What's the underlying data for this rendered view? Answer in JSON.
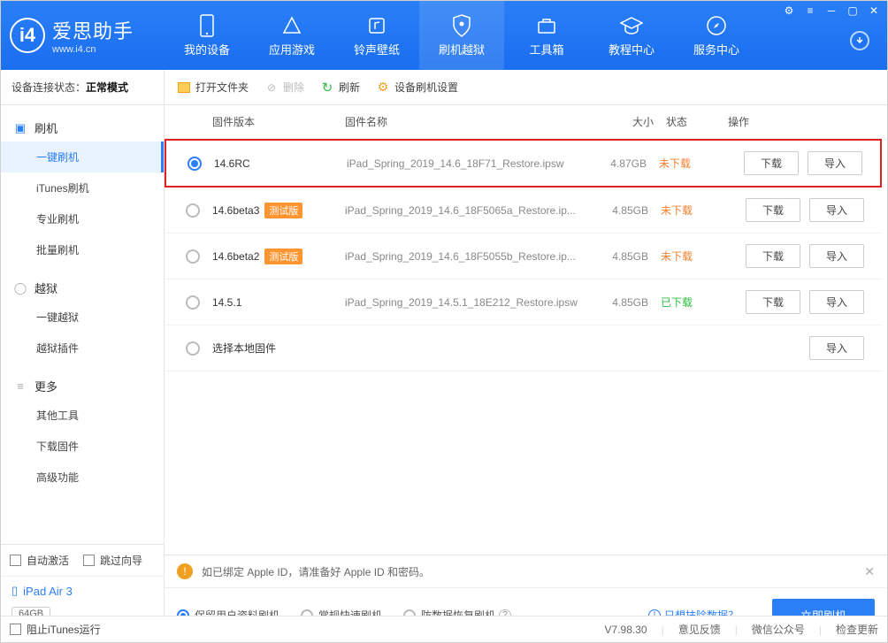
{
  "brand": {
    "name": "爱思助手",
    "url": "www.i4.cn"
  },
  "nav": {
    "items": [
      {
        "label": "我的设备"
      },
      {
        "label": "应用游戏"
      },
      {
        "label": "铃声壁纸"
      },
      {
        "label": "刷机越狱"
      },
      {
        "label": "工具箱"
      },
      {
        "label": "教程中心"
      },
      {
        "label": "服务中心"
      }
    ]
  },
  "toolbar": {
    "status_label": "设备连接状态：",
    "status_value": "正常模式",
    "open_folder": "打开文件夹",
    "delete": "删除",
    "refresh": "刷新",
    "device_settings": "设备刷机设置"
  },
  "sidebar": {
    "g1": "刷机",
    "g1_items": [
      "一键刷机",
      "iTunes刷机",
      "专业刷机",
      "批量刷机"
    ],
    "g2": "越狱",
    "g2_items": [
      "一键越狱",
      "越狱插件"
    ],
    "g3": "更多",
    "g3_items": [
      "其他工具",
      "下载固件",
      "高级功能"
    ],
    "auto_activate": "自动激活",
    "skip_guide": "跳过向导",
    "device_name": "iPad Air 3",
    "storage": "64GB",
    "device_type": "iPad"
  },
  "table": {
    "headers": {
      "version": "固件版本",
      "name": "固件名称",
      "size": "大小",
      "status": "状态",
      "action": "操作"
    },
    "download_btn": "下载",
    "import_btn": "导入",
    "status_no": "未下载",
    "status_yes": "已下载",
    "beta_tag": "测试版",
    "rows": [
      {
        "version": "14.6RC",
        "beta": false,
        "name": "iPad_Spring_2019_14.6_18F71_Restore.ipsw",
        "size": "4.87GB",
        "downloaded": false
      },
      {
        "version": "14.6beta3",
        "beta": true,
        "name": "iPad_Spring_2019_14.6_18F5065a_Restore.ip...",
        "size": "4.85GB",
        "downloaded": false
      },
      {
        "version": "14.6beta2",
        "beta": true,
        "name": "iPad_Spring_2019_14.6_18F5055b_Restore.ip...",
        "size": "4.85GB",
        "downloaded": false
      },
      {
        "version": "14.5.1",
        "beta": false,
        "name": "iPad_Spring_2019_14.5.1_18E212_Restore.ipsw",
        "size": "4.85GB",
        "downloaded": true
      }
    ],
    "local_row": "选择本地固件"
  },
  "warning": "如已绑定 Apple ID，请准备好 Apple ID 和密码。",
  "options": {
    "keep_data": "保留用户资料刷机",
    "fast": "常规快速刷机",
    "recover": "防数据恢复刷机",
    "erase_link": "只想抹除数据？",
    "flash_btn": "立即刷机"
  },
  "footer": {
    "block_itunes": "阻止iTunes运行",
    "version": "V7.98.30",
    "feedback": "意见反馈",
    "wechat": "微信公众号",
    "update": "检查更新"
  }
}
